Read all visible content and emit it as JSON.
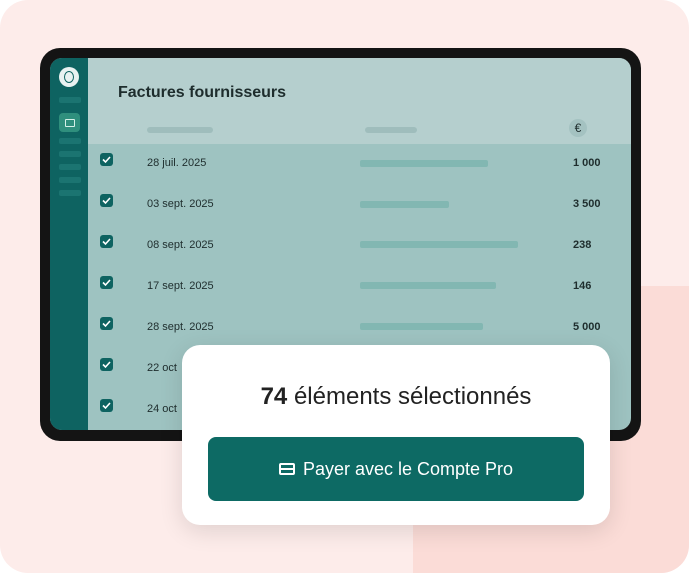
{
  "colors": {
    "brand": "#0d6a64",
    "background": "#fdecea",
    "sidebar": "#0e6361"
  },
  "table": {
    "title": "Factures fournisseurs",
    "currency_icon": "€",
    "rows": [
      {
        "date": "28 juil. 2025",
        "amount": "1 000",
        "checked": true
      },
      {
        "date": "03 sept. 2025",
        "amount": "3 500",
        "checked": true
      },
      {
        "date": "08 sept. 2025",
        "amount": "238",
        "checked": true
      },
      {
        "date": "17 sept. 2025",
        "amount": "146",
        "checked": true
      },
      {
        "date": "28 sept. 2025",
        "amount": "5 000",
        "checked": true
      },
      {
        "date": "22 oct",
        "amount": "",
        "checked": true
      },
      {
        "date": "24 oct",
        "amount": "",
        "checked": true
      }
    ]
  },
  "popup": {
    "count": "74",
    "selection_text": "éléments sélectionnés",
    "pay_button_label": "Payer avec le Compte Pro",
    "pay_button_icon": "credit-card-icon"
  }
}
